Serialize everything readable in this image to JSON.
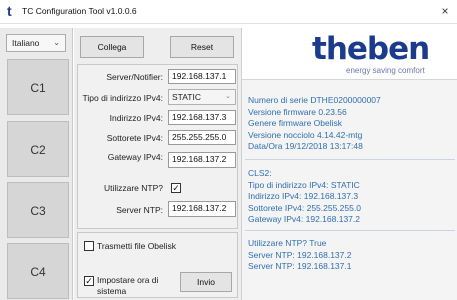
{
  "window": {
    "app_icon": "t",
    "title": "TC Configuration Tool v1.0.0.6",
    "close_glyph": "×"
  },
  "sidebar": {
    "language": "Italiano",
    "items": [
      {
        "label": "C1"
      },
      {
        "label": "C2"
      },
      {
        "label": "C3"
      },
      {
        "label": "C4"
      }
    ]
  },
  "toolbar": {
    "connect_label": "Collega",
    "reset_label": "Reset"
  },
  "network": {
    "server_label": "Server/Notifier:",
    "server_value": "192.168.137.1",
    "ip_type_label": "Tipo di indirizzo IPv4:",
    "ip_type_value": "STATIC",
    "address_label": "Indirizzo IPv4:",
    "address_value": "192.168.137.3",
    "subnet_label": "Sottorete IPv4:",
    "subnet_value": "255.255.255.0",
    "gateway_label": "Gateway IPv4:",
    "gateway_value": "192.168.137.2",
    "use_ntp_label": "Utilizzare NTP?",
    "use_ntp_checked": "✓",
    "ntp_server_label": "Server NTP:",
    "ntp_server_value": "192.168.137.2"
  },
  "actions": {
    "transmit_label": "Trasmetti file Obelisk",
    "set_time_label_1": "Impostare ora di",
    "set_time_label_2": "sistema",
    "set_time_checked": "✓",
    "send_label": "Invio"
  },
  "brand": {
    "name": "theben",
    "tagline": "energy saving comfort",
    "color": "#1b3c8c"
  },
  "info": {
    "device_lines": [
      "Numero di serie DTHE0200000007",
      "Versione firmware 0.23.56",
      "Genere firmware Obelisk",
      "Versione nocciolo 4.14.42-mtg",
      "Data/Ora 19/12/2018 13:17:48"
    ],
    "cls_lines": [
      "CLS2:",
      "Tipo di indirizzo IPv4: STATIC",
      "Indirizzo IPv4: 192.168.137.3",
      "Sottorete IPv4: 255.255.255.0",
      "Gateway IPv4: 192.168.137.2"
    ],
    "ntp_lines": [
      "Utilizzare NTP? True",
      "Server NTP: 192.168.137.2",
      "Server NTP: 192.168.137.1"
    ],
    "text_color": "#2f6fb0"
  }
}
